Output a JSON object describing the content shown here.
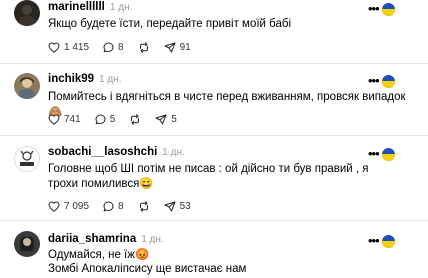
{
  "posts": [
    {
      "username": "marinellllll",
      "time": "1 дн.",
      "text": "Якщо будете їсти, передайте привіт моїй бабі",
      "likes": "1 415",
      "comments": "8",
      "reposts": "",
      "shares": "91",
      "avatar": "dark-photo"
    },
    {
      "username": "inchik99",
      "time": "1 дн.",
      "text": "Помийтесь і вдягніться в чисте перед вживанням, провсяк випадок 🙈",
      "likes": "741",
      "comments": "5",
      "reposts": "",
      "shares": "5",
      "avatar": "photo"
    },
    {
      "username": "sobachi__lasoshchi",
      "time": "1 дн.",
      "text": "Головне щоб ШІ потім не писав : ой дійсно ти був правий , я трохи помилився😄",
      "likes": "7 095",
      "comments": "8",
      "reposts": "",
      "shares": "53",
      "avatar": "logo"
    },
    {
      "username": "dariia_shamrina",
      "time": "1 дн.",
      "text_line1": "Одумайся, не їж😡",
      "text_line2": "Зомбі Апокаліпсису ще вистачає нам",
      "avatar": "photo-dark"
    }
  ],
  "icons": {
    "like": "heart-icon",
    "comment": "comment-icon",
    "repost": "repost-icon",
    "share": "share-icon",
    "more": "more-icon"
  },
  "colors": {
    "flag_blue": "#1f4fb8",
    "flag_yellow": "#f5d300",
    "heart_red": "#e0245e",
    "muted": "#999999"
  }
}
